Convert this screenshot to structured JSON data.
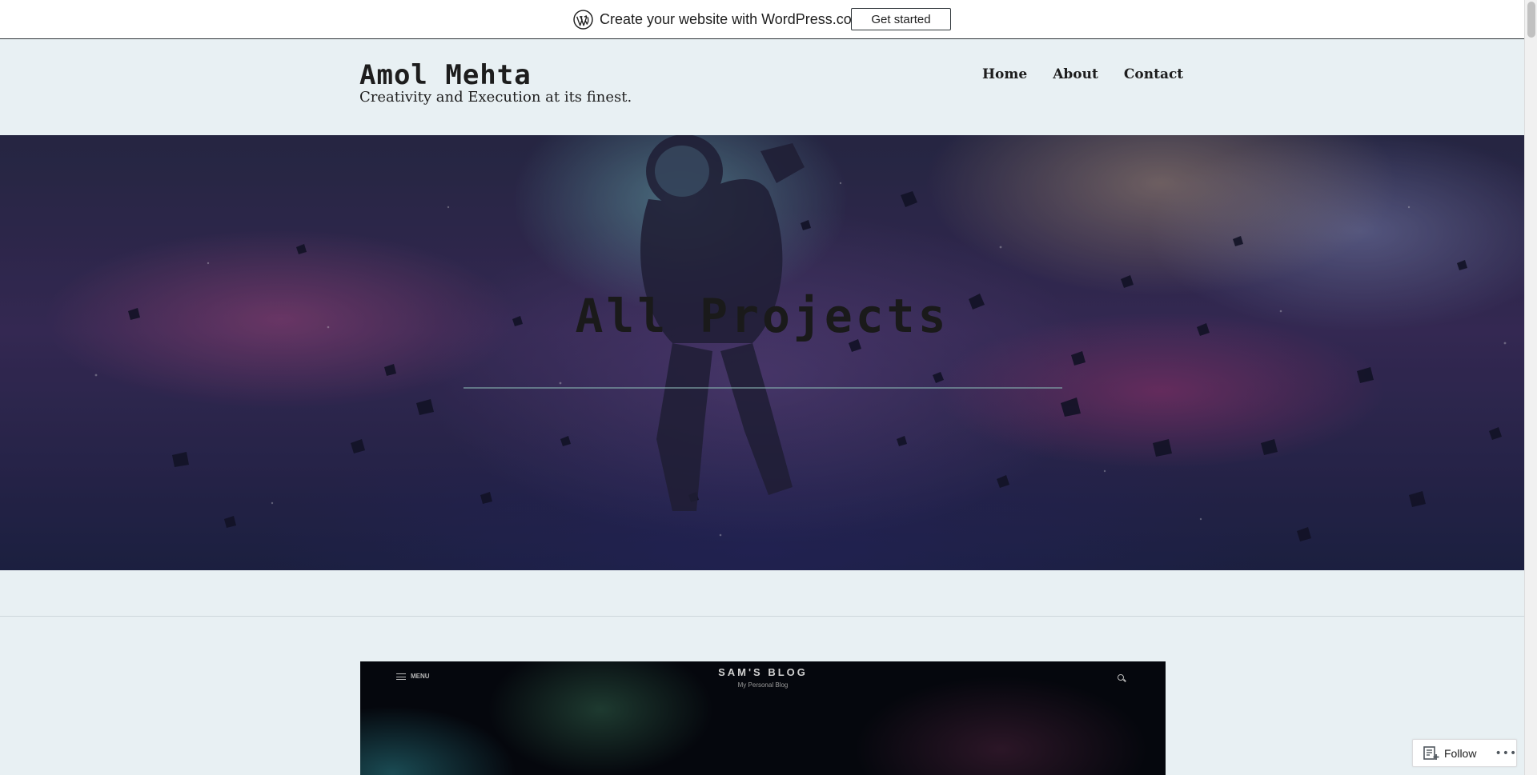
{
  "wp_banner": {
    "cta_text": "Create your website with WordPress.com",
    "button_label": "Get started"
  },
  "header": {
    "site_title": "Amol Mehta",
    "tagline": "Creativity and Execution at its finest."
  },
  "nav": {
    "items": [
      {
        "label": "Home"
      },
      {
        "label": "About"
      },
      {
        "label": "Contact"
      }
    ]
  },
  "hero": {
    "title": "All Projects"
  },
  "project_preview": {
    "menu_label": "MENU",
    "blog_title": "SAM'S BLOG",
    "blog_subtitle": "My Personal Blog"
  },
  "follow_widget": {
    "follow_label": "Follow",
    "more_label": "•••"
  },
  "colors": {
    "page_background": "#e8f0f3",
    "text_dark": "#1d1d1d",
    "banner_border": "#2c3338"
  }
}
